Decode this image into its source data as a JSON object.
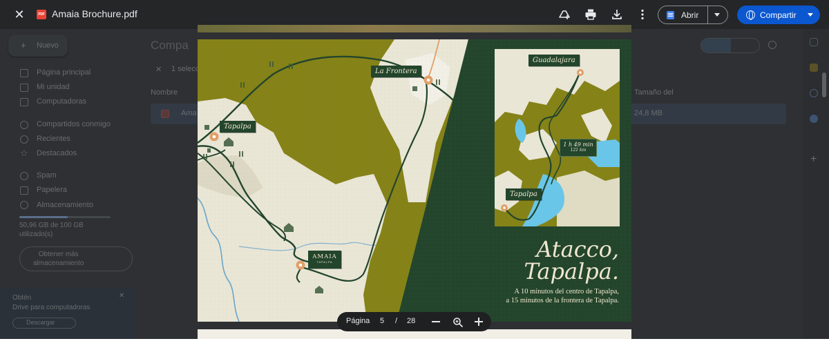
{
  "viewer": {
    "file_name": "Amaia Brochure.pdf",
    "file_type_badge": "PDF",
    "open_label": "Abrir",
    "share_label": "Compartir",
    "page_label": "Página",
    "current_page": "5",
    "page_separator": "/",
    "total_pages": "28",
    "icons": [
      "close-icon",
      "add-to-drive-icon",
      "print-icon",
      "download-icon",
      "more-vert-icon",
      "docs-icon",
      "globe-icon",
      "zoom-out-icon",
      "zoom-icon",
      "zoom-in-icon"
    ]
  },
  "drive_background": {
    "new_button": "Nuevo",
    "breadcrumb": "Compa",
    "selection_count": "1 selecc",
    "nav_items": [
      "Página principal",
      "Mi unidad",
      "Computadoras",
      "Compartidos conmigo",
      "Recientes",
      "Destacados",
      "Spam",
      "Papelera",
      "Almacenamiento"
    ],
    "storage_text": "50,96 GB de 100 GB",
    "storage_text_2": "utilizado(s)",
    "get_more_storage": "Obtener más\nalmacenamiento",
    "promo_title": "Obtén",
    "promo_text": "Drive para computadoras",
    "promo_button": "Descargar",
    "column_name": "Nombre",
    "column_size": "Tamaño del",
    "row_file_name": "Ama",
    "row_file_size": "24,8 MB"
  },
  "brochure": {
    "labels": {
      "la_frontera": "La Frontera",
      "tapalpa": "Tapalpa",
      "amaia": "AMAIA",
      "amaia_sub": "TAPALPA",
      "guadalajara": "Guadalajara",
      "tapalpa_inset": "Tapalpa",
      "drive_time": "1 h 49 min",
      "drive_distance": "121 km"
    },
    "title_line_1": "Atacco,",
    "title_line_2": "Tapalpa.",
    "subtitle_line_1": "A 10 minutos del centro de Tapalpa,",
    "subtitle_line_2": "a 15 minutos de la frontera de Tapalpa."
  },
  "colors": {
    "olive": "#858218",
    "dark_green": "#23452c",
    "cream": "#e9e6d6",
    "pin": "#e0a06a",
    "river": "#6aa5c9",
    "share_blue": "#0b57d0"
  }
}
